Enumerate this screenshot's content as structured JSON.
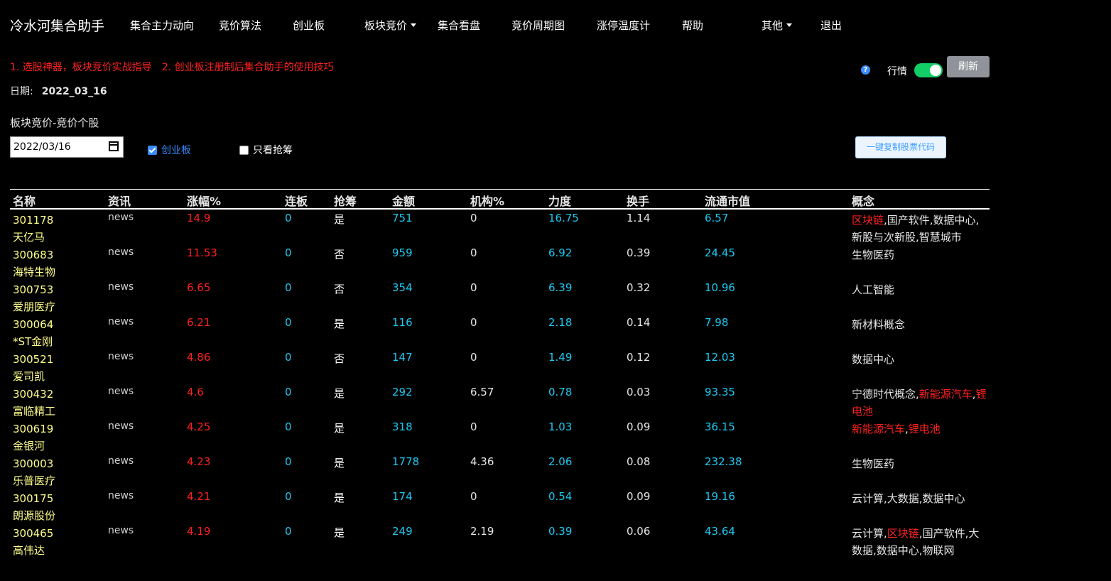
{
  "nav": {
    "brand": "冷水河集合助手",
    "items": [
      "集合主力动向",
      "竞价算法",
      "创业板",
      "板块竞价",
      "集合看盘",
      "竞价周期图",
      "涨停温度计",
      "帮助",
      "其他",
      "退出"
    ]
  },
  "notice": {
    "link1": "1. 选股神器，板块竞价实战指导",
    "link2": "2. 创业板注册制后集合助手的使用技巧"
  },
  "date_line": {
    "label": "日期:",
    "value": "2022_03_16"
  },
  "controls": {
    "help_glyph": "?",
    "toggle_label": "行情",
    "toggle_on": true,
    "refresh_label": "刷新",
    "section_title": "板块竞价-竞价个股",
    "date_input": "2022/03/16",
    "checkbox_cyb": {
      "label": "创业板",
      "checked": true
    },
    "checkbox_qc": {
      "label": "只看抢筹",
      "checked": false
    },
    "copy_label": "一键复制股票代码"
  },
  "table": {
    "headers": [
      "名称",
      "资讯",
      "涨幅%",
      "连板",
      "抢筹",
      "金额",
      "机构%",
      "力度",
      "换手",
      "流通市值",
      "概念"
    ],
    "rows": [
      {
        "code": "301178",
        "name": "天亿马",
        "news": "news",
        "zf": "14.9",
        "lb": "0",
        "qc": "是",
        "je": "751",
        "jg": "0",
        "ld": "16.75",
        "hs": "1.14",
        "lt": "6.57",
        "concepts": [
          {
            "t": "区块链",
            "hot": true
          },
          {
            "t": ",国产软件,数据中心,新股与次新股,智慧城市",
            "hot": false
          }
        ]
      },
      {
        "code": "300683",
        "name": "海特生物",
        "news": "news",
        "zf": "11.53",
        "lb": "0",
        "qc": "否",
        "je": "959",
        "jg": "0",
        "ld": "6.92",
        "hs": "0.39",
        "lt": "24.45",
        "concepts": [
          {
            "t": "生物医药",
            "hot": false
          }
        ]
      },
      {
        "code": "300753",
        "name": "爱朋医疗",
        "news": "news",
        "zf": "6.65",
        "lb": "0",
        "qc": "否",
        "je": "354",
        "jg": "0",
        "ld": "6.39",
        "hs": "0.32",
        "lt": "10.96",
        "concepts": [
          {
            "t": "人工智能",
            "hot": false
          }
        ]
      },
      {
        "code": "300064",
        "name": "*ST金刚",
        "news": "news",
        "zf": "6.21",
        "lb": "0",
        "qc": "是",
        "je": "116",
        "jg": "0",
        "ld": "2.18",
        "hs": "0.14",
        "lt": "7.98",
        "concepts": [
          {
            "t": "新材料概念",
            "hot": false
          }
        ]
      },
      {
        "code": "300521",
        "name": "爱司凯",
        "news": "news",
        "zf": "4.86",
        "lb": "0",
        "qc": "否",
        "je": "147",
        "jg": "0",
        "ld": "1.49",
        "hs": "0.12",
        "lt": "12.03",
        "concepts": [
          {
            "t": "数据中心",
            "hot": false
          }
        ]
      },
      {
        "code": "300432",
        "name": "富临精工",
        "news": "news",
        "zf": "4.6",
        "lb": "0",
        "qc": "是",
        "je": "292",
        "jg": "6.57",
        "ld": "0.78",
        "hs": "0.03",
        "lt": "93.35",
        "concepts": [
          {
            "t": "宁德时代概念,",
            "hot": false
          },
          {
            "t": "新能源汽车",
            "hot": true
          },
          {
            "t": ",",
            "hot": false
          },
          {
            "t": "锂电池",
            "hot": true
          }
        ]
      },
      {
        "code": "300619",
        "name": "金银河",
        "news": "news",
        "zf": "4.25",
        "lb": "0",
        "qc": "是",
        "je": "318",
        "jg": "0",
        "ld": "1.03",
        "hs": "0.09",
        "lt": "36.15",
        "concepts": [
          {
            "t": "新能源汽车",
            "hot": true
          },
          {
            "t": ",",
            "hot": false
          },
          {
            "t": "锂电池",
            "hot": true
          }
        ]
      },
      {
        "code": "300003",
        "name": "乐普医疗",
        "news": "news",
        "zf": "4.23",
        "lb": "0",
        "qc": "是",
        "je": "1778",
        "jg": "4.36",
        "ld": "2.06",
        "hs": "0.08",
        "lt": "232.38",
        "concepts": [
          {
            "t": "生物医药",
            "hot": false
          }
        ]
      },
      {
        "code": "300175",
        "name": "朗源股份",
        "news": "news",
        "zf": "4.21",
        "lb": "0",
        "qc": "是",
        "je": "174",
        "jg": "0",
        "ld": "0.54",
        "hs": "0.09",
        "lt": "19.16",
        "concepts": [
          {
            "t": "云计算,大数据,数据中心",
            "hot": false
          }
        ]
      },
      {
        "code": "300465",
        "name": "高伟达",
        "news": "news",
        "zf": "4.19",
        "lb": "0",
        "qc": "是",
        "je": "249",
        "jg": "2.19",
        "ld": "0.39",
        "hs": "0.06",
        "lt": "43.64",
        "concepts": [
          {
            "t": "云计算,",
            "hot": false
          },
          {
            "t": "区块链",
            "hot": true
          },
          {
            "t": ",国产软件,大数据,数据中心,物联网",
            "hot": false
          }
        ]
      }
    ]
  },
  "colors": {
    "up": "#ff2020",
    "cyan": "#1ec8f0",
    "name": "#ffff8c",
    "toggle": "#13ce66",
    "link": "#3b8cff"
  }
}
